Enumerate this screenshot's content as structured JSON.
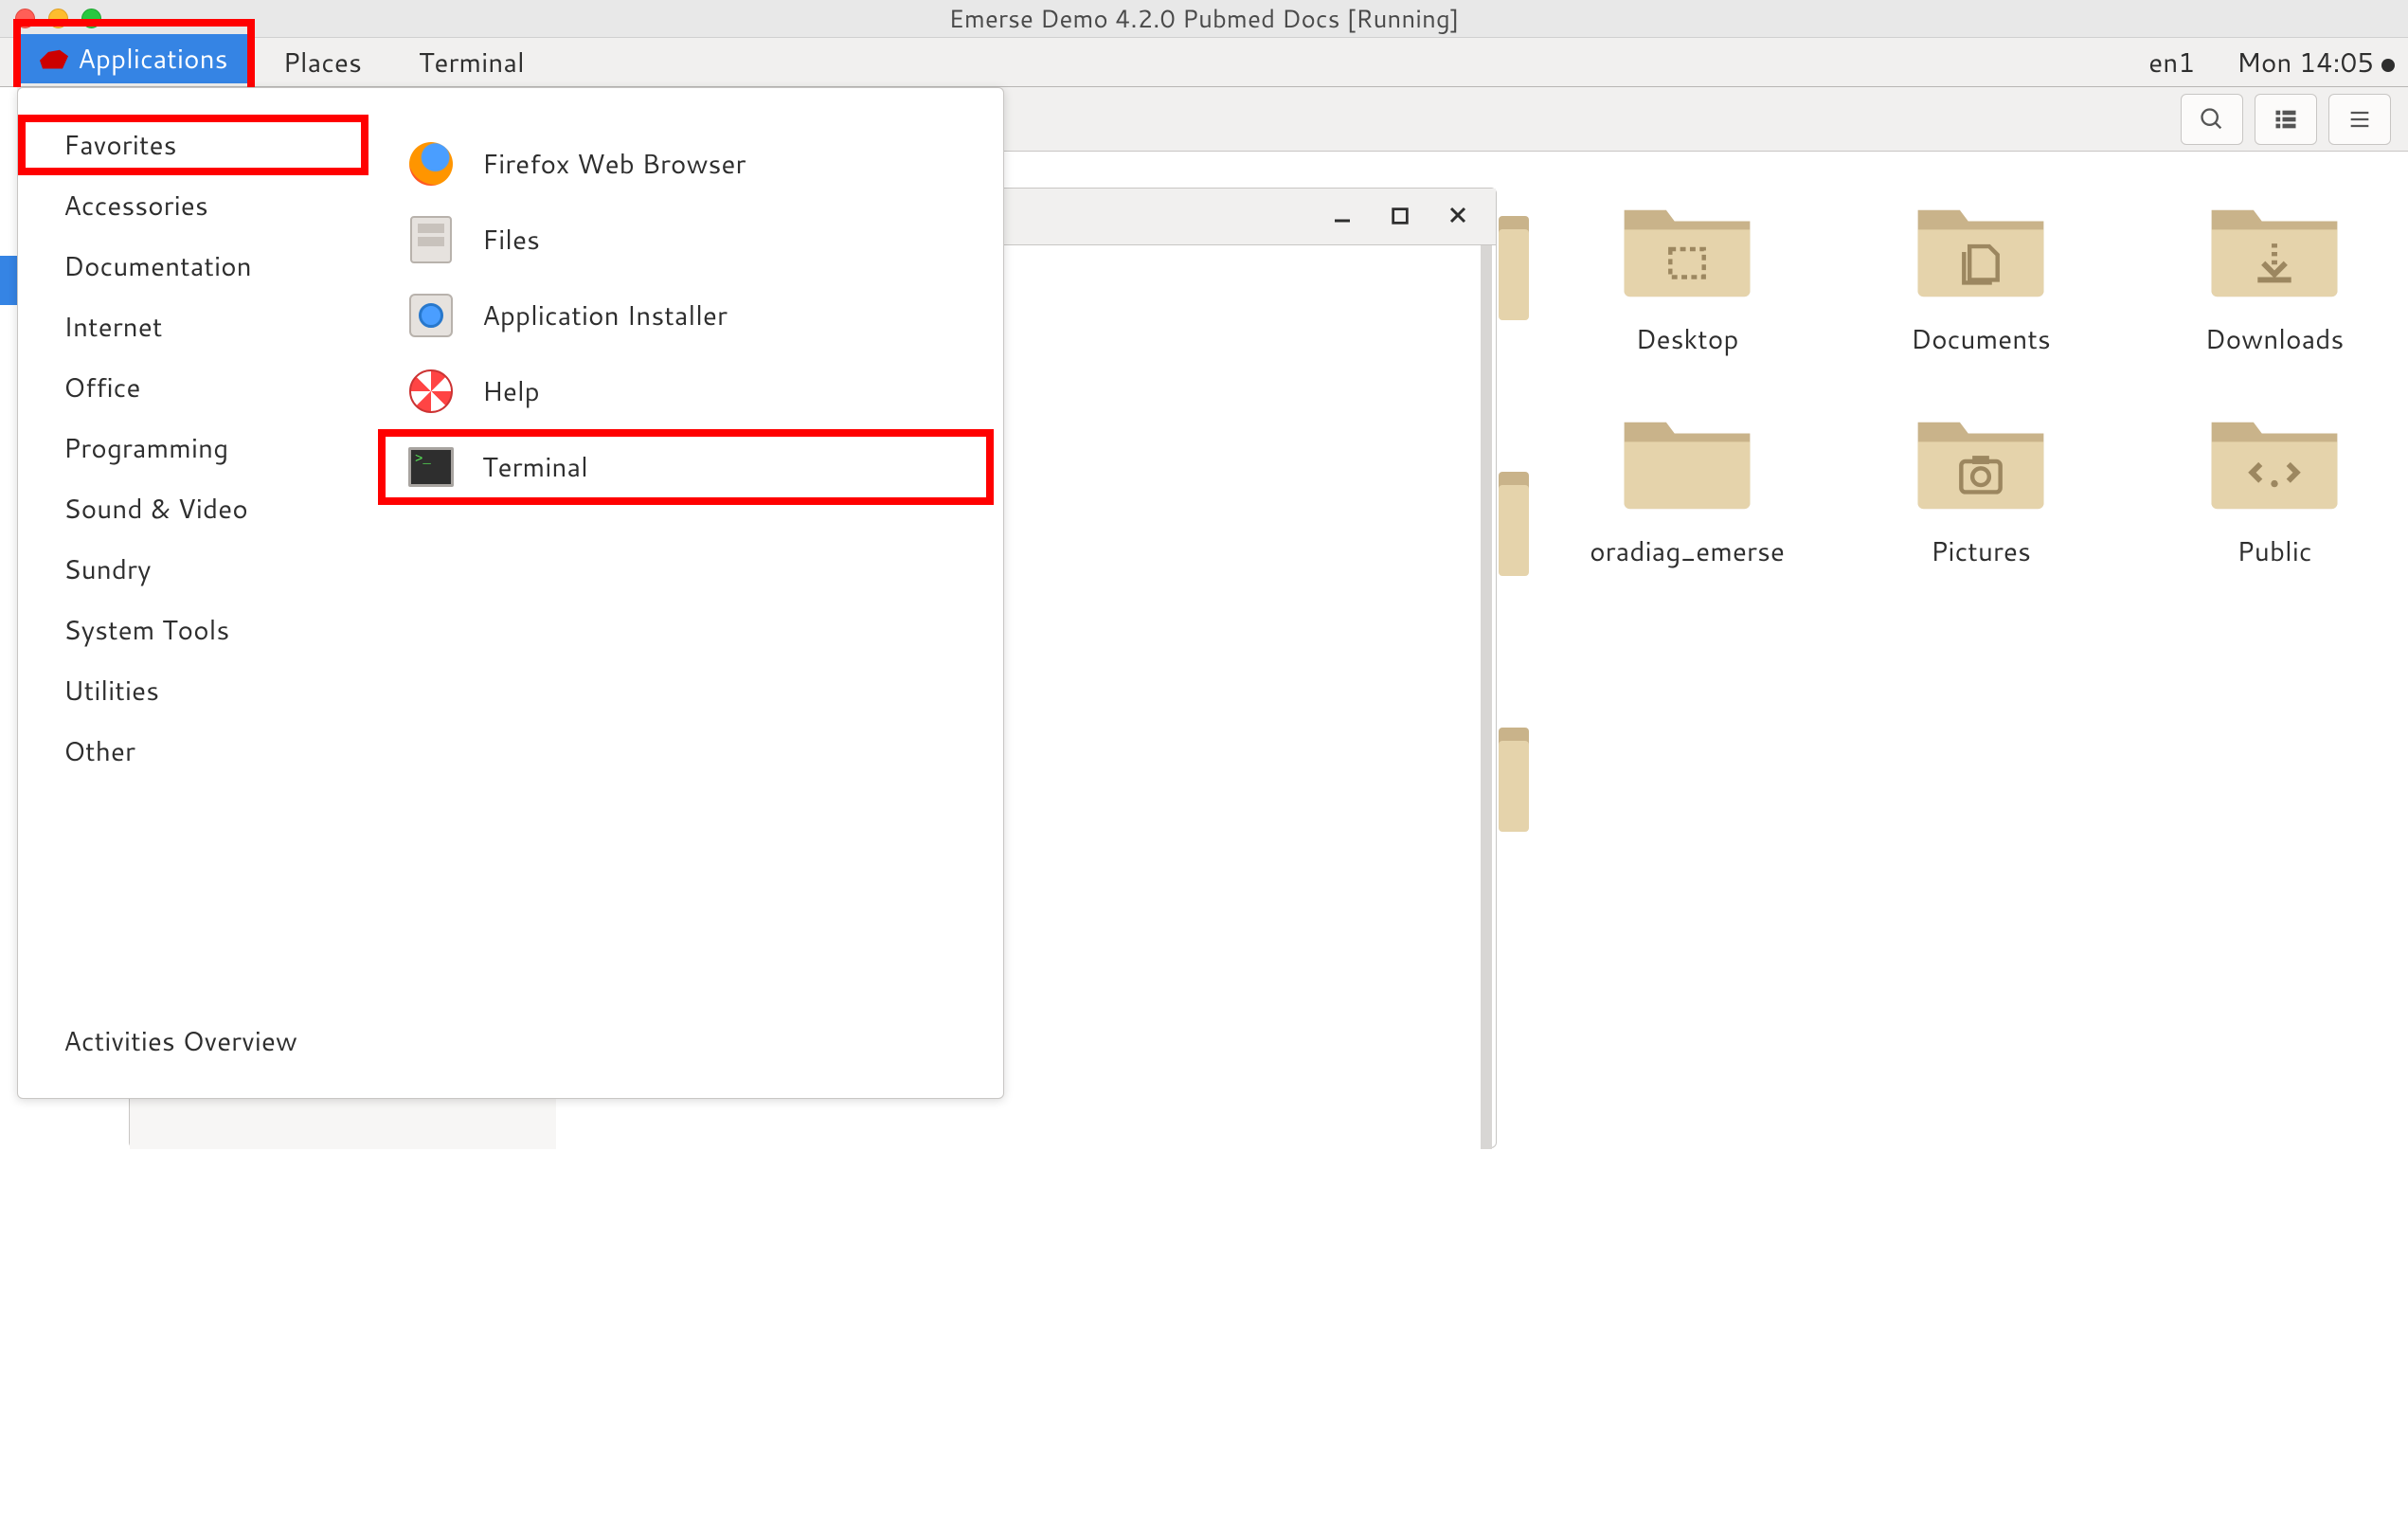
{
  "mac_title": "Emerse Demo 4.2.0 Pubmed Docs [Running]",
  "gnome": {
    "applications": "Applications",
    "places": "Places",
    "terminal": "Terminal",
    "layout": "en1",
    "clock": "Mon 14:05"
  },
  "apps_menu": {
    "categories": [
      "Favorites",
      "Accessories",
      "Documentation",
      "Internet",
      "Office",
      "Programming",
      "Sound & Video",
      "Sundry",
      "System Tools",
      "Utilities",
      "Other"
    ],
    "activities": "Activities Overview",
    "favorites": [
      "Firefox Web Browser",
      "Files",
      "Application Installer",
      "Help",
      "Terminal"
    ]
  },
  "folders": [
    "Desktop",
    "Documents",
    "Downloads",
    "oradiag_emerse",
    "Pictures",
    "Public"
  ]
}
